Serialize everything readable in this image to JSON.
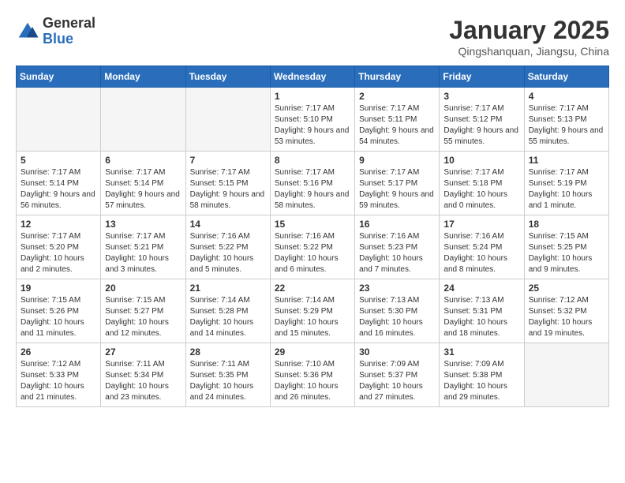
{
  "logo": {
    "general": "General",
    "blue": "Blue"
  },
  "header": {
    "title": "January 2025",
    "subtitle": "Qingshanquan, Jiangsu, China"
  },
  "weekdays": [
    "Sunday",
    "Monday",
    "Tuesday",
    "Wednesday",
    "Thursday",
    "Friday",
    "Saturday"
  ],
  "weeks": [
    [
      {
        "day": "",
        "info": ""
      },
      {
        "day": "",
        "info": ""
      },
      {
        "day": "",
        "info": ""
      },
      {
        "day": "1",
        "info": "Sunrise: 7:17 AM\nSunset: 5:10 PM\nDaylight: 9 hours\nand 53 minutes."
      },
      {
        "day": "2",
        "info": "Sunrise: 7:17 AM\nSunset: 5:11 PM\nDaylight: 9 hours\nand 54 minutes."
      },
      {
        "day": "3",
        "info": "Sunrise: 7:17 AM\nSunset: 5:12 PM\nDaylight: 9 hours\nand 55 minutes."
      },
      {
        "day": "4",
        "info": "Sunrise: 7:17 AM\nSunset: 5:13 PM\nDaylight: 9 hours\nand 55 minutes."
      }
    ],
    [
      {
        "day": "5",
        "info": "Sunrise: 7:17 AM\nSunset: 5:14 PM\nDaylight: 9 hours\nand 56 minutes."
      },
      {
        "day": "6",
        "info": "Sunrise: 7:17 AM\nSunset: 5:14 PM\nDaylight: 9 hours\nand 57 minutes."
      },
      {
        "day": "7",
        "info": "Sunrise: 7:17 AM\nSunset: 5:15 PM\nDaylight: 9 hours\nand 58 minutes."
      },
      {
        "day": "8",
        "info": "Sunrise: 7:17 AM\nSunset: 5:16 PM\nDaylight: 9 hours\nand 58 minutes."
      },
      {
        "day": "9",
        "info": "Sunrise: 7:17 AM\nSunset: 5:17 PM\nDaylight: 9 hours\nand 59 minutes."
      },
      {
        "day": "10",
        "info": "Sunrise: 7:17 AM\nSunset: 5:18 PM\nDaylight: 10 hours\nand 0 minutes."
      },
      {
        "day": "11",
        "info": "Sunrise: 7:17 AM\nSunset: 5:19 PM\nDaylight: 10 hours\nand 1 minute."
      }
    ],
    [
      {
        "day": "12",
        "info": "Sunrise: 7:17 AM\nSunset: 5:20 PM\nDaylight: 10 hours\nand 2 minutes."
      },
      {
        "day": "13",
        "info": "Sunrise: 7:17 AM\nSunset: 5:21 PM\nDaylight: 10 hours\nand 3 minutes."
      },
      {
        "day": "14",
        "info": "Sunrise: 7:16 AM\nSunset: 5:22 PM\nDaylight: 10 hours\nand 5 minutes."
      },
      {
        "day": "15",
        "info": "Sunrise: 7:16 AM\nSunset: 5:22 PM\nDaylight: 10 hours\nand 6 minutes."
      },
      {
        "day": "16",
        "info": "Sunrise: 7:16 AM\nSunset: 5:23 PM\nDaylight: 10 hours\nand 7 minutes."
      },
      {
        "day": "17",
        "info": "Sunrise: 7:16 AM\nSunset: 5:24 PM\nDaylight: 10 hours\nand 8 minutes."
      },
      {
        "day": "18",
        "info": "Sunrise: 7:15 AM\nSunset: 5:25 PM\nDaylight: 10 hours\nand 9 minutes."
      }
    ],
    [
      {
        "day": "19",
        "info": "Sunrise: 7:15 AM\nSunset: 5:26 PM\nDaylight: 10 hours\nand 11 minutes."
      },
      {
        "day": "20",
        "info": "Sunrise: 7:15 AM\nSunset: 5:27 PM\nDaylight: 10 hours\nand 12 minutes."
      },
      {
        "day": "21",
        "info": "Sunrise: 7:14 AM\nSunset: 5:28 PM\nDaylight: 10 hours\nand 14 minutes."
      },
      {
        "day": "22",
        "info": "Sunrise: 7:14 AM\nSunset: 5:29 PM\nDaylight: 10 hours\nand 15 minutes."
      },
      {
        "day": "23",
        "info": "Sunrise: 7:13 AM\nSunset: 5:30 PM\nDaylight: 10 hours\nand 16 minutes."
      },
      {
        "day": "24",
        "info": "Sunrise: 7:13 AM\nSunset: 5:31 PM\nDaylight: 10 hours\nand 18 minutes."
      },
      {
        "day": "25",
        "info": "Sunrise: 7:12 AM\nSunset: 5:32 PM\nDaylight: 10 hours\nand 19 minutes."
      }
    ],
    [
      {
        "day": "26",
        "info": "Sunrise: 7:12 AM\nSunset: 5:33 PM\nDaylight: 10 hours\nand 21 minutes."
      },
      {
        "day": "27",
        "info": "Sunrise: 7:11 AM\nSunset: 5:34 PM\nDaylight: 10 hours\nand 23 minutes."
      },
      {
        "day": "28",
        "info": "Sunrise: 7:11 AM\nSunset: 5:35 PM\nDaylight: 10 hours\nand 24 minutes."
      },
      {
        "day": "29",
        "info": "Sunrise: 7:10 AM\nSunset: 5:36 PM\nDaylight: 10 hours\nand 26 minutes."
      },
      {
        "day": "30",
        "info": "Sunrise: 7:09 AM\nSunset: 5:37 PM\nDaylight: 10 hours\nand 27 minutes."
      },
      {
        "day": "31",
        "info": "Sunrise: 7:09 AM\nSunset: 5:38 PM\nDaylight: 10 hours\nand 29 minutes."
      },
      {
        "day": "",
        "info": ""
      }
    ]
  ]
}
